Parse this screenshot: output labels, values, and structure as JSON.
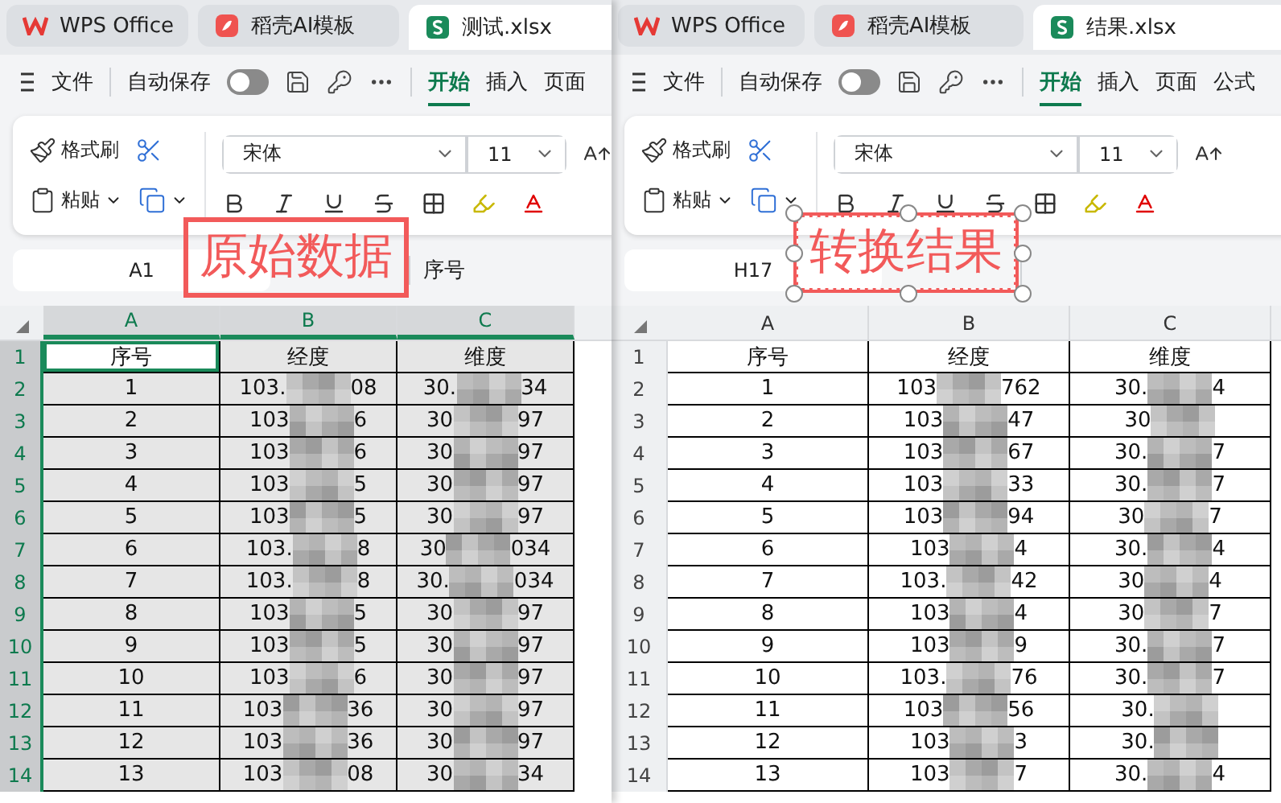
{
  "windows": [
    {
      "tabs": [
        {
          "label": "WPS Office",
          "kind": "wps",
          "selected": false
        },
        {
          "label": "稻壳AI模板",
          "kind": "docer",
          "selected": false
        },
        {
          "label": "测试.xlsx",
          "kind": "sheet",
          "selected": true
        }
      ],
      "menu": {
        "file": "文件",
        "autosave": {
          "label": "自动保存",
          "on": false
        },
        "tabs": [
          {
            "label": "开始",
            "selected": true
          },
          {
            "label": "插入",
            "selected": false
          },
          {
            "label": "页面",
            "selected": false
          }
        ]
      },
      "ribbon": {
        "format_painter": "格式刷",
        "paste": "粘贴",
        "font": "宋体",
        "size": "11"
      },
      "formula_bar": {
        "cell": "A1",
        "value": "序号"
      },
      "annotation": {
        "text": "原始数据",
        "selected": false
      },
      "grid": {
        "columns": [
          {
            "label": "A",
            "selected": true
          },
          {
            "label": "B",
            "selected": true
          },
          {
            "label": "C",
            "selected": true
          }
        ],
        "rows": [
          {
            "number": "1",
            "selected": true,
            "cells": [
              {
                "kind": "text",
                "text": "序号",
                "active": true
              },
              {
                "kind": "text",
                "text": "经度",
                "active": false
              },
              {
                "kind": "text",
                "text": "维度",
                "active": false
              }
            ]
          },
          {
            "number": "2",
            "selected": true,
            "cells": [
              {
                "kind": "text",
                "text": "1",
                "active": false
              },
              {
                "kind": "masked",
                "start": "103.",
                "end": "08",
                "active": false
              },
              {
                "kind": "masked",
                "start": "30.",
                "end": "34",
                "active": false
              }
            ]
          },
          {
            "number": "3",
            "selected": true,
            "cells": [
              {
                "kind": "text",
                "text": "2",
                "active": false
              },
              {
                "kind": "masked",
                "start": "103",
                "end": "6",
                "active": false
              },
              {
                "kind": "masked",
                "start": "30",
                "end": "97",
                "active": false
              }
            ]
          },
          {
            "number": "4",
            "selected": true,
            "cells": [
              {
                "kind": "text",
                "text": "3",
                "active": false
              },
              {
                "kind": "masked",
                "start": "103",
                "end": "6",
                "active": false
              },
              {
                "kind": "masked",
                "start": "30",
                "end": "97",
                "active": false
              }
            ]
          },
          {
            "number": "5",
            "selected": true,
            "cells": [
              {
                "kind": "text",
                "text": "4",
                "active": false
              },
              {
                "kind": "masked",
                "start": "103",
                "end": "5",
                "active": false
              },
              {
                "kind": "masked",
                "start": "30",
                "end": "97",
                "active": false
              }
            ]
          },
          {
            "number": "6",
            "selected": true,
            "cells": [
              {
                "kind": "text",
                "text": "5",
                "active": false
              },
              {
                "kind": "masked",
                "start": "103",
                "end": "5",
                "active": false
              },
              {
                "kind": "masked",
                "start": "30",
                "end": "97",
                "active": false
              }
            ]
          },
          {
            "number": "7",
            "selected": true,
            "cells": [
              {
                "kind": "text",
                "text": "6",
                "active": false
              },
              {
                "kind": "masked",
                "start": "103.",
                "end": "8",
                "active": false
              },
              {
                "kind": "masked",
                "start": "30",
                "end": "034",
                "active": false
              }
            ]
          },
          {
            "number": "8",
            "selected": true,
            "cells": [
              {
                "kind": "text",
                "text": "7",
                "active": false
              },
              {
                "kind": "masked",
                "start": "103.",
                "end": "8",
                "active": false
              },
              {
                "kind": "masked",
                "start": "30.",
                "end": "034",
                "active": false
              }
            ]
          },
          {
            "number": "9",
            "selected": true,
            "cells": [
              {
                "kind": "text",
                "text": "8",
                "active": false
              },
              {
                "kind": "masked",
                "start": "103",
                "end": "5",
                "active": false
              },
              {
                "kind": "masked",
                "start": "30",
                "end": "97",
                "active": false
              }
            ]
          },
          {
            "number": "10",
            "selected": true,
            "cells": [
              {
                "kind": "text",
                "text": "9",
                "active": false
              },
              {
                "kind": "masked",
                "start": "103",
                "end": "5",
                "active": false
              },
              {
                "kind": "masked",
                "start": "30",
                "end": "97",
                "active": false
              }
            ]
          },
          {
            "number": "11",
            "selected": true,
            "cells": [
              {
                "kind": "text",
                "text": "10",
                "active": false
              },
              {
                "kind": "masked",
                "start": "103",
                "end": "6",
                "active": false
              },
              {
                "kind": "masked",
                "start": "30",
                "end": "97",
                "active": false
              }
            ]
          },
          {
            "number": "12",
            "selected": true,
            "cells": [
              {
                "kind": "text",
                "text": "11",
                "active": false
              },
              {
                "kind": "masked",
                "start": "103",
                "end": "36",
                "active": false
              },
              {
                "kind": "masked",
                "start": "30",
                "end": "97",
                "active": false
              }
            ]
          },
          {
            "number": "13",
            "selected": true,
            "cells": [
              {
                "kind": "text",
                "text": "12",
                "active": false
              },
              {
                "kind": "masked",
                "start": "103",
                "end": "36",
                "active": false
              },
              {
                "kind": "masked",
                "start": "30",
                "end": "97",
                "active": false
              }
            ]
          },
          {
            "number": "14",
            "selected": true,
            "cells": [
              {
                "kind": "text",
                "text": "13",
                "active": false
              },
              {
                "kind": "masked",
                "start": "103",
                "end": "08",
                "active": false
              },
              {
                "kind": "masked",
                "start": "30",
                "end": "34",
                "active": false
              }
            ]
          }
        ]
      }
    },
    {
      "tabs": [
        {
          "label": "WPS Office",
          "kind": "wps",
          "selected": false
        },
        {
          "label": "稻壳AI模板",
          "kind": "docer",
          "selected": false
        },
        {
          "label": "结果.xlsx",
          "kind": "sheet",
          "selected": true
        }
      ],
      "menu": {
        "file": "文件",
        "autosave": {
          "label": "自动保存",
          "on": false
        },
        "tabs": [
          {
            "label": "开始",
            "selected": true
          },
          {
            "label": "插入",
            "selected": false
          },
          {
            "label": "页面",
            "selected": false
          },
          {
            "label": "公式",
            "selected": false
          }
        ]
      },
      "ribbon": {
        "format_painter": "格式刷",
        "paste": "粘贴",
        "font": "宋体",
        "size": "11"
      },
      "formula_bar": {
        "cell": "H17"
      },
      "annotation": {
        "text": "转换结果",
        "selected": true
      },
      "grid": {
        "columns": [
          {
            "label": "A",
            "selected": false
          },
          {
            "label": "B",
            "selected": false
          },
          {
            "label": "C",
            "selected": false
          }
        ],
        "rows": [
          {
            "number": "1",
            "selected": false,
            "cells": [
              {
                "kind": "text",
                "text": "序号"
              },
              {
                "kind": "text",
                "text": "经度"
              },
              {
                "kind": "text",
                "text": "维度"
              }
            ]
          },
          {
            "number": "2",
            "selected": false,
            "cells": [
              {
                "kind": "text",
                "text": "1"
              },
              {
                "kind": "masked",
                "start": "103",
                "end": "762"
              },
              {
                "kind": "masked",
                "start": "30.",
                "end": "4"
              }
            ]
          },
          {
            "number": "3",
            "selected": false,
            "cells": [
              {
                "kind": "text",
                "text": "2"
              },
              {
                "kind": "masked",
                "start": "103",
                "end": "47"
              },
              {
                "kind": "masked",
                "start": "30"
              }
            ]
          },
          {
            "number": "4",
            "selected": false,
            "cells": [
              {
                "kind": "text",
                "text": "3"
              },
              {
                "kind": "masked",
                "start": "103",
                "end": "67"
              },
              {
                "kind": "masked",
                "start": "30.",
                "end": "7"
              }
            ]
          },
          {
            "number": "5",
            "selected": false,
            "cells": [
              {
                "kind": "text",
                "text": "4"
              },
              {
                "kind": "masked",
                "start": "103",
                "end": "33"
              },
              {
                "kind": "masked",
                "start": "30.",
                "end": "7"
              }
            ]
          },
          {
            "number": "6",
            "selected": false,
            "cells": [
              {
                "kind": "text",
                "text": "5"
              },
              {
                "kind": "masked",
                "start": "103",
                "end": "94"
              },
              {
                "kind": "masked",
                "start": "30",
                "end": "7"
              }
            ]
          },
          {
            "number": "7",
            "selected": false,
            "cells": [
              {
                "kind": "text",
                "text": "6"
              },
              {
                "kind": "masked",
                "start": "103",
                "end": "4"
              },
              {
                "kind": "masked",
                "start": "30.",
                "end": "4"
              }
            ]
          },
          {
            "number": "8",
            "selected": false,
            "cells": [
              {
                "kind": "text",
                "text": "7"
              },
              {
                "kind": "masked",
                "start": "103.",
                "end": "42"
              },
              {
                "kind": "masked",
                "start": "30",
                "end": "4"
              }
            ]
          },
          {
            "number": "9",
            "selected": false,
            "cells": [
              {
                "kind": "text",
                "text": "8"
              },
              {
                "kind": "masked",
                "start": "103",
                "end": "4"
              },
              {
                "kind": "masked",
                "start": "30",
                "end": "7"
              }
            ]
          },
          {
            "number": "10",
            "selected": false,
            "cells": [
              {
                "kind": "text",
                "text": "9"
              },
              {
                "kind": "masked",
                "start": "103",
                "end": "9"
              },
              {
                "kind": "masked",
                "start": "30.",
                "end": "7"
              }
            ]
          },
          {
            "number": "11",
            "selected": false,
            "cells": [
              {
                "kind": "text",
                "text": "10"
              },
              {
                "kind": "masked",
                "start": "103.",
                "end": "76"
              },
              {
                "kind": "masked",
                "start": "30.",
                "end": "7"
              }
            ]
          },
          {
            "number": "12",
            "selected": false,
            "cells": [
              {
                "kind": "text",
                "text": "11"
              },
              {
                "kind": "masked",
                "start": "103",
                "end": "56"
              },
              {
                "kind": "masked",
                "start": "30."
              }
            ]
          },
          {
            "number": "13",
            "selected": false,
            "cells": [
              {
                "kind": "text",
                "text": "12"
              },
              {
                "kind": "masked",
                "start": "103",
                "end": "3"
              },
              {
                "kind": "masked",
                "start": "30."
              }
            ]
          },
          {
            "number": "14",
            "selected": false,
            "cells": [
              {
                "kind": "text",
                "text": "13"
              },
              {
                "kind": "masked",
                "start": "103",
                "end": "7"
              },
              {
                "kind": "masked",
                "start": "30.",
                "end": "4"
              }
            ]
          }
        ]
      }
    }
  ]
}
